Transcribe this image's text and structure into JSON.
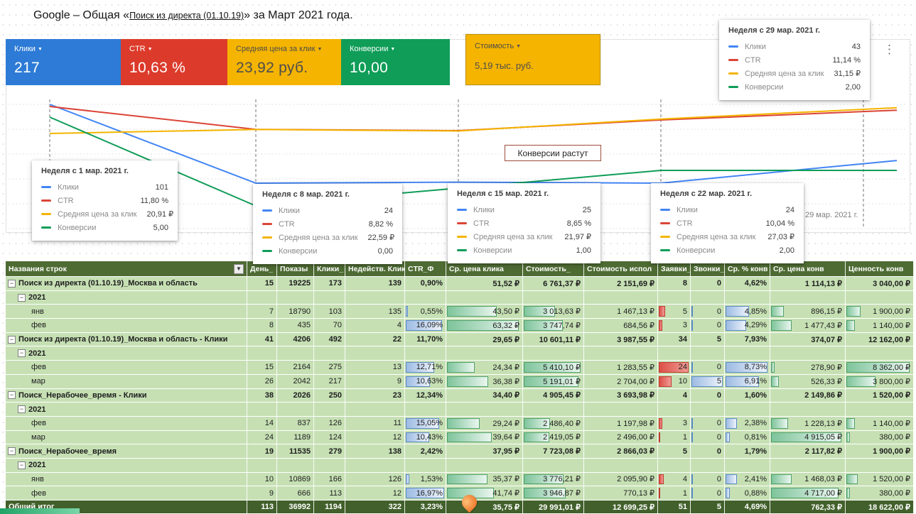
{
  "title": {
    "prefix": "Google – Общая «",
    "underlined": "Поиск из директа (01.10.19)",
    "suffix": "» за Март 2021 года."
  },
  "icons": {
    "dropdown": "▼",
    "more_vertical": "⋮",
    "collapse": "−"
  },
  "scorecards": [
    {
      "label": "Клики",
      "value": "217",
      "bg": "#2d7bd6",
      "fg": "#ffffff"
    },
    {
      "label": "CTR",
      "value": "10,63 %",
      "bg": "#dc3b2b",
      "fg": "#ffffff"
    },
    {
      "label": "Средняя цена за клик",
      "value": "23,92 руб.",
      "bg": "#f5b400",
      "fg": "#4d4d4d"
    },
    {
      "label": "Конверсии",
      "value": "10,00",
      "bg": "#0f9d58",
      "fg": "#ffffff"
    }
  ],
  "cost_tile": {
    "label": "Стоимость",
    "value": "5,19 тыс. руб.",
    "bg": "#f5b400",
    "fg": "#4d4d4d"
  },
  "annotation": "Конверсии растут",
  "chart_data": {
    "type": "line",
    "x": [
      "Неделя с 1 мар. 2021 г.",
      "Неделя с 8 мар. 2021 г.",
      "Неделя с 15 мар. 2021 г.",
      "Неделя с 22 мар. 2021 г.",
      "Неделя с 29 мар. 2021 г."
    ],
    "x_axis_label": "29 мар. 2021 г.",
    "grid": true,
    "legend_position": "tooltip",
    "series": [
      {
        "name": "Клики",
        "color": "#4285f4",
        "values": [
          101,
          24,
          25,
          24,
          43
        ]
      },
      {
        "name": "CTR",
        "color": "#db4437",
        "unit": "%",
        "values": [
          11.8,
          8.82,
          8.65,
          10.04,
          11.14
        ]
      },
      {
        "name": "Средняя цена за клик",
        "color": "#f4b400",
        "unit": "₽",
        "values": [
          20.91,
          22.59,
          21.97,
          27.03,
          31.15
        ]
      },
      {
        "name": "Конверсии",
        "color": "#0f9d58",
        "values": [
          5.0,
          0.0,
          1.0,
          2.0,
          2.0
        ]
      }
    ]
  },
  "tooltips": [
    {
      "title": "Неделя с 1 мар. 2021 г.",
      "rows": [
        [
          "Клики",
          "101"
        ],
        [
          "CTR",
          "11,80 %"
        ],
        [
          "Средняя цена за клик",
          "20,91 ₽"
        ],
        [
          "Конверсии",
          "5,00"
        ]
      ]
    },
    {
      "title": "Неделя с 8 мар. 2021 г.",
      "rows": [
        [
          "Клики",
          "24"
        ],
        [
          "CTR",
          "8,82 %"
        ],
        [
          "Средняя цена за клик",
          "22,59 ₽"
        ],
        [
          "Конверсии",
          "0,00"
        ]
      ]
    },
    {
      "title": "Неделя с 15 мар. 2021 г.",
      "rows": [
        [
          "Клики",
          "25"
        ],
        [
          "CTR",
          "8,65 %"
        ],
        [
          "Средняя цена за клик",
          "21,97 ₽"
        ],
        [
          "Конверсии",
          "1,00"
        ]
      ]
    },
    {
      "title": "Неделя с 22 мар. 2021 г.",
      "rows": [
        [
          "Клики",
          "24"
        ],
        [
          "CTR",
          "10,04 %"
        ],
        [
          "Средняя цена за клик",
          "27,03 ₽"
        ],
        [
          "Конверсии",
          "2,00"
        ]
      ]
    },
    {
      "title": "Неделя с 29 мар. 2021 г.",
      "rows": [
        [
          "Клики",
          "43"
        ],
        [
          "CTR",
          "11,14 %"
        ],
        [
          "Средняя цена за клик",
          "31,15 ₽"
        ],
        [
          "Конверсии",
          "2,00"
        ]
      ]
    }
  ],
  "table": {
    "headers": [
      "Названия строк",
      "День_",
      "Показы",
      "Клики_",
      "Недейств. Клики",
      "CTR_Ф",
      "Ср. цена клика",
      "Стоимость_",
      "Стоимость испол",
      "Заявки_",
      "Звонки_",
      "Ср. % конв",
      "Ср. цена конв",
      "Ценность конв"
    ],
    "bar_columns": {
      "4": "blue",
      "5": "green",
      "6": "green",
      "8": "red",
      "9": "blue",
      "10": "blue",
      "11": "green",
      "12": "green"
    },
    "colors": {
      "header_bg": "#4e6b33",
      "total_bg": "#42602b",
      "row_bg": "#c6e0b4"
    },
    "rows": [
      {
        "type": "group",
        "label": "Поиск из директа (01.10.19)_Москва и область",
        "cells": [
          "15",
          "19225",
          "173",
          "139",
          "0,90%",
          "51,52 ₽",
          "6 761,37 ₽",
          "2 151,69 ₽",
          "8",
          "0",
          "4,62%",
          "1 114,13 ₽",
          "3 040,00 ₽"
        ]
      },
      {
        "type": "year",
        "label": "2021",
        "cells": []
      },
      {
        "type": "month",
        "label": "янв",
        "cells": [
          "7",
          "18790",
          "103",
          "135",
          "0,55%",
          "43,50 ₽",
          "3 013,63 ₽",
          "1 467,13 ₽",
          "5",
          "0",
          "4,85%",
          "896,15 ₽",
          "1 900,00 ₽"
        ]
      },
      {
        "type": "month",
        "label": "фев",
        "cells": [
          "8",
          "435",
          "70",
          "4",
          "16,09%",
          "63,32 ₽",
          "3 747,74 ₽",
          "684,56 ₽",
          "3",
          "0",
          "4,29%",
          "1 477,43 ₽",
          "1 140,00 ₽"
        ]
      },
      {
        "type": "group",
        "label": "Поиск из директа (01.10.19)_Москва и область - Клики",
        "cells": [
          "41",
          "4206",
          "492",
          "22",
          "11,70%",
          "29,65 ₽",
          "10 601,11 ₽",
          "3 987,55 ₽",
          "34",
          "5",
          "7,93%",
          "374,07 ₽",
          "12 162,00 ₽"
        ]
      },
      {
        "type": "year",
        "label": "2021",
        "cells": []
      },
      {
        "type": "month",
        "label": "фев",
        "cells": [
          "15",
          "2164",
          "275",
          "13",
          "12,71%",
          "24,34 ₽",
          "5 410,10 ₽",
          "1 283,55 ₽",
          "24",
          "0",
          "8,73%",
          "278,90 ₽",
          "8 362,00 ₽"
        ]
      },
      {
        "type": "month",
        "label": "мар",
        "cells": [
          "26",
          "2042",
          "217",
          "9",
          "10,63%",
          "36,38 ₽",
          "5 191,01 ₽",
          "2 704,00 ₽",
          "10",
          "5",
          "6,91%",
          "526,33 ₽",
          "3 800,00 ₽"
        ]
      },
      {
        "type": "group",
        "label": "Поиск_Нерабочее_время - Клики",
        "cells": [
          "38",
          "2026",
          "250",
          "23",
          "12,34%",
          "34,40 ₽",
          "4 905,45 ₽",
          "3 693,98 ₽",
          "4",
          "0",
          "1,60%",
          "2 149,86 ₽",
          "1 520,00 ₽"
        ]
      },
      {
        "type": "year",
        "label": "2021",
        "cells": []
      },
      {
        "type": "month",
        "label": "фев",
        "cells": [
          "14",
          "837",
          "126",
          "11",
          "15,05%",
          "29,24 ₽",
          "2 486,40 ₽",
          "1 197,98 ₽",
          "3",
          "0",
          "2,38%",
          "1 228,13 ₽",
          "1 140,00 ₽"
        ]
      },
      {
        "type": "month",
        "label": "мар",
        "cells": [
          "24",
          "1189",
          "124",
          "12",
          "10,43%",
          "39,64 ₽",
          "2 419,05 ₽",
          "2 496,00 ₽",
          "1",
          "0",
          "0,81%",
          "4 915,05 ₽",
          "380,00 ₽"
        ]
      },
      {
        "type": "group",
        "label": "Поиск_Нерабочее_время",
        "cells": [
          "19",
          "11535",
          "279",
          "138",
          "2,42%",
          "37,95 ₽",
          "7 723,08 ₽",
          "2 866,03 ₽",
          "5",
          "0",
          "1,79%",
          "2 117,82 ₽",
          "1 900,00 ₽"
        ]
      },
      {
        "type": "year",
        "label": "2021",
        "cells": []
      },
      {
        "type": "month",
        "label": "янв",
        "cells": [
          "10",
          "10869",
          "166",
          "126",
          "1,53%",
          "35,37 ₽",
          "3 776,21 ₽",
          "2 095,90 ₽",
          "4",
          "0",
          "2,41%",
          "1 468,03 ₽",
          "1 520,00 ₽"
        ]
      },
      {
        "type": "month",
        "label": "фев",
        "cells": [
          "9",
          "666",
          "113",
          "12",
          "16,97%",
          "41,74 ₽",
          "3 946,87 ₽",
          "770,13 ₽",
          "1",
          "0",
          "0,88%",
          "4 717,00 ₽",
          "380,00 ₽"
        ]
      }
    ],
    "total": {
      "label": "Общий итог",
      "cells": [
        "113",
        "36992",
        "1194",
        "322",
        "3,23%",
        "35,75 ₽",
        "29 991,01 ₽",
        "12 699,25 ₽",
        "51",
        "5",
        "4,69%",
        "762,33 ₽",
        "18 622,00 ₽"
      ]
    }
  }
}
